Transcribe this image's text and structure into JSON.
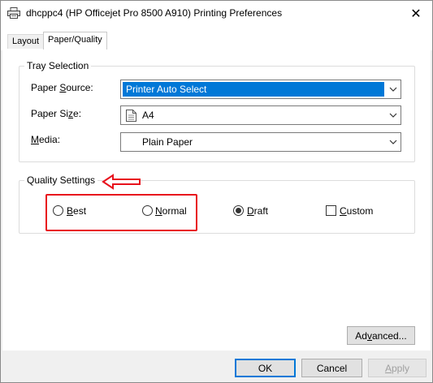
{
  "window": {
    "title": "dhcppc4 (HP Officejet Pro 8500 A910) Printing Preferences",
    "close_glyph": "✕"
  },
  "tabs": [
    {
      "label": "Layout",
      "active": false
    },
    {
      "label": "Paper/Quality",
      "active": true
    }
  ],
  "tray_selection": {
    "title": "Tray Selection",
    "paper_source": {
      "label_pre": "Paper ",
      "label_u": "S",
      "label_post": "ource:",
      "value": "Printer Auto Select"
    },
    "paper_size": {
      "label_pre": "Paper Si",
      "label_u": "z",
      "label_post": "e:",
      "value": "A4",
      "icon": "document-icon"
    },
    "media": {
      "label_pre": "",
      "label_u": "M",
      "label_post": "edia:",
      "value": "Plain Paper"
    }
  },
  "quality_settings": {
    "title": "Quality Settings",
    "options": [
      {
        "label_u": "B",
        "label_rest": "est",
        "type": "radio",
        "checked": false
      },
      {
        "label_u": "N",
        "label_rest": "ormal",
        "type": "radio",
        "checked": false
      },
      {
        "label_u": "D",
        "label_rest": "raft",
        "type": "radio",
        "checked": true
      },
      {
        "label_u": "C",
        "label_rest": "ustom",
        "type": "checkbox",
        "checked": false
      }
    ]
  },
  "annotation": {
    "color": "#e8111c"
  },
  "buttons": {
    "advanced_u": "v",
    "advanced_pre": "Ad",
    "advanced_post": "anced...",
    "ok": "OK",
    "cancel": "Cancel",
    "apply_u": "A",
    "apply_post": "pply"
  },
  "colors": {
    "accent": "#0078d7",
    "panel": "#ffffff",
    "chrome": "#f0f0f0"
  }
}
